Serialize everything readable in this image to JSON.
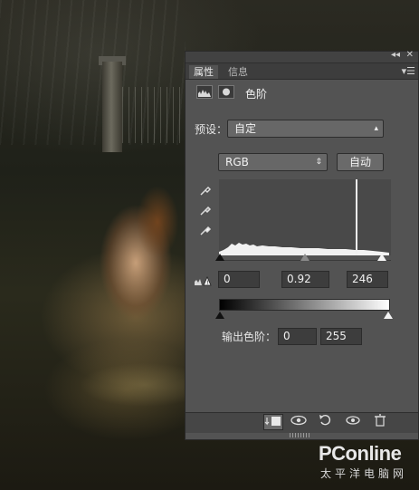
{
  "panel": {
    "tabs": [
      {
        "label": "属性",
        "active": true
      },
      {
        "label": "信息",
        "active": false
      }
    ],
    "header_title": "色阶",
    "preset": {
      "label": "预设：",
      "value": "自定"
    },
    "channel": {
      "value": "RGB"
    },
    "auto_button": "自动",
    "input_levels": {
      "black": "0",
      "gamma": "0.92",
      "white": "246"
    },
    "output_levels": {
      "label": "输出色阶：",
      "black": "0",
      "white": "255"
    },
    "input_slider_positions": {
      "black": 0,
      "gamma": 0.5,
      "white": 1.0
    },
    "output_slider_positions": {
      "black": 0,
      "white": 1.0
    }
  },
  "bottom_toolbar": {
    "icons": [
      "clip-to-layer-icon",
      "view-previous-state-icon",
      "reset-icon",
      "toggle-visibility-icon",
      "delete-icon"
    ]
  },
  "watermark": {
    "logo": "PConline",
    "subtitle": "太平洋电脑网"
  },
  "colors": {
    "panel_bg": "#535353",
    "histogram_bg": "#494949",
    "arrow": "#c0201e"
  }
}
